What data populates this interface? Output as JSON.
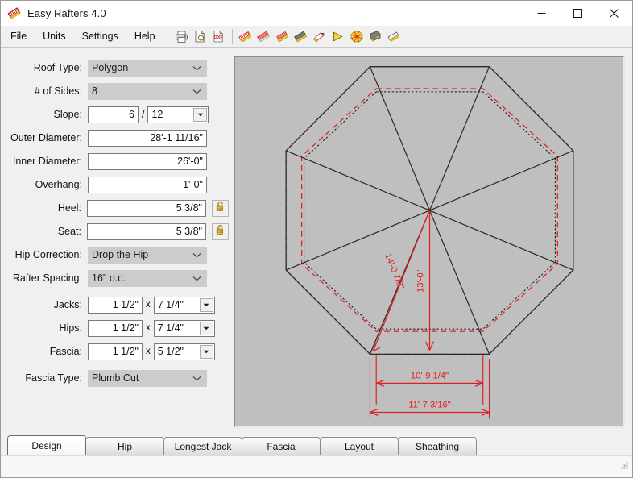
{
  "window": {
    "title": "Easy Rafters 4.0",
    "app_icon": "rafter-icon",
    "minimize_label": "Minimize",
    "maximize_label": "Maximize",
    "close_label": "Close"
  },
  "menu": {
    "items": [
      {
        "label": "File"
      },
      {
        "label": "Units"
      },
      {
        "label": "Settings"
      },
      {
        "label": "Help"
      }
    ]
  },
  "toolbar": {
    "groups": [
      [
        {
          "name": "print-icon",
          "tip": "Print"
        },
        {
          "name": "print-preview-icon",
          "tip": "Print Preview"
        },
        {
          "name": "dxf-export-icon",
          "tip": "DXF",
          "label": "DXF"
        }
      ],
      [
        {
          "name": "common-rafter-icon",
          "tip": "Common Rafter"
        },
        {
          "name": "hip-rafter-icon",
          "tip": "Hip Rafter"
        },
        {
          "name": "jack-rafter-icon",
          "tip": "Jack Rafter"
        },
        {
          "name": "valley-rafter-icon",
          "tip": "Valley Rafter"
        },
        {
          "name": "rafter-cut-icon",
          "tip": "Rafter Cut"
        },
        {
          "name": "fascia-icon",
          "tip": "Fascia"
        },
        {
          "name": "polygon-roof-icon",
          "tip": "Polygon Roof"
        },
        {
          "name": "sheathing-icon",
          "tip": "Sheathing"
        },
        {
          "name": "layout-icon",
          "tip": "Layout"
        }
      ]
    ]
  },
  "form": {
    "roof_type": {
      "label": "Roof Type:",
      "value": "Polygon",
      "type": "combo"
    },
    "sides": {
      "label": "# of Sides:",
      "value": "8",
      "type": "combo"
    },
    "slope": {
      "label": "Slope:",
      "rise": "6",
      "separator": "/",
      "run": "12"
    },
    "outer_diameter": {
      "label": "Outer Diameter:",
      "value": "28'-1 11/16\""
    },
    "inner_diameter": {
      "label": "Inner Diameter:",
      "value": "26'-0\""
    },
    "overhang": {
      "label": "Overhang:",
      "value": "1'-0\""
    },
    "heel": {
      "label": "Heel:",
      "value": "5 3/8\"",
      "lock": "unlocked-padlock"
    },
    "seat": {
      "label": "Seat:",
      "value": "5 3/8\"",
      "lock": "unlocked-padlock"
    },
    "hip_correction": {
      "label": "Hip Correction:",
      "value": "Drop the Hip",
      "type": "combo"
    },
    "rafter_spacing": {
      "label": "Rafter Spacing:",
      "value": "16\" o.c.",
      "type": "combo"
    },
    "jacks": {
      "label": "Jacks:",
      "thickness": "1 1/2\"",
      "x": "x",
      "width": "7 1/4\""
    },
    "hips": {
      "label": "Hips:",
      "thickness": "1 1/2\"",
      "x": "x",
      "width": "7 1/4\""
    },
    "fascia": {
      "label": "Fascia:",
      "thickness": "1 1/2\"",
      "x": "x",
      "width": "5 1/2\""
    },
    "fascia_type": {
      "label": "Fascia Type:",
      "value": "Plumb Cut",
      "type": "combo"
    }
  },
  "drawing": {
    "shape": "octagon",
    "sides": 8,
    "dimensions": {
      "hip_run": "14'-0 7/8\"",
      "common_run": "13'-0\"",
      "inner_side": "10'-9 1/4\"",
      "outer_side": "11'-7 3/16\""
    },
    "colors": {
      "dimension": "#e02020",
      "outline": "#2b2b2b",
      "background": "#bfbfbf",
      "overhang_dash": "#e02020",
      "inner_dot": "#1a1a1a"
    }
  },
  "tabs": {
    "items": [
      {
        "label": "Design",
        "active": true
      },
      {
        "label": "Hip",
        "active": false
      },
      {
        "label": "Longest Jack",
        "active": false
      },
      {
        "label": "Fascia",
        "active": false
      },
      {
        "label": "Layout",
        "active": false
      },
      {
        "label": "Sheathing",
        "active": false
      }
    ]
  },
  "statusbar": {
    "grip": "resize-grip"
  }
}
